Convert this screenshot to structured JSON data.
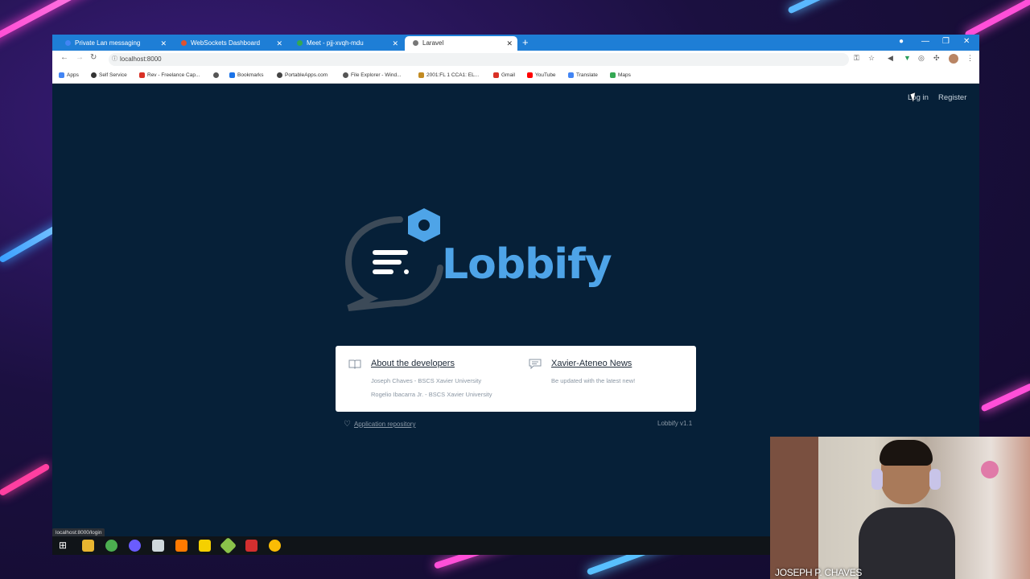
{
  "browser": {
    "tabs": [
      {
        "title": "Private Lan messaging Applicati...",
        "favicon_color": "#4285f4"
      },
      {
        "title": "WebSockets Dashboard",
        "favicon_color": "#e0522e"
      },
      {
        "title": "Meet - pjj-xvqh-mdu",
        "favicon_color": "#34a853"
      },
      {
        "title": "Laravel",
        "favicon_color": "#777777"
      }
    ],
    "new_tab": "+",
    "address": "localhost:8000",
    "bookmarks": [
      {
        "label": "Apps",
        "color": "#4285f4"
      },
      {
        "label": "Self Service",
        "color": "#333333"
      },
      {
        "label": "Rev - Freelance Cap...",
        "color": "#d93025"
      },
      {
        "label": "",
        "color": "#555555"
      },
      {
        "label": "Bookmarks",
        "color": "#1a73e8"
      },
      {
        "label": "PortableApps.com",
        "color": "#444444"
      },
      {
        "label": "File Explorer - Wind...",
        "color": "#555555"
      },
      {
        "label": "2001:FL 1 CCA1: EL...",
        "color": "#c28b22"
      },
      {
        "label": "Gmail",
        "color": "#d93025"
      },
      {
        "label": "YouTube",
        "color": "#ff0000"
      },
      {
        "label": "Translate",
        "color": "#4285f4"
      },
      {
        "label": "Maps",
        "color": "#34a853"
      }
    ]
  },
  "page": {
    "login": "Log in",
    "register": "Register",
    "logo_text": "Lobbify",
    "card": {
      "about_title": "About the developers",
      "about_lines": [
        "Joseph Chaves - BSCS Xavier University",
        "Rogelio Ibacarra Jr. - BSCS Xavier University"
      ],
      "news_title": "Xavier-Ateneo News",
      "news_sub": "Be updated with the latest new!"
    },
    "repo_link": "Application repository",
    "version": "Lobbify v1.1",
    "status_url": "localhost:8000/login"
  },
  "webcam": {
    "name": "JOSEPH P. CHAVES"
  },
  "colors": {
    "accent": "#4ea4e8",
    "page_bg": "#062038",
    "tab_bar": "#1e7ed6"
  }
}
